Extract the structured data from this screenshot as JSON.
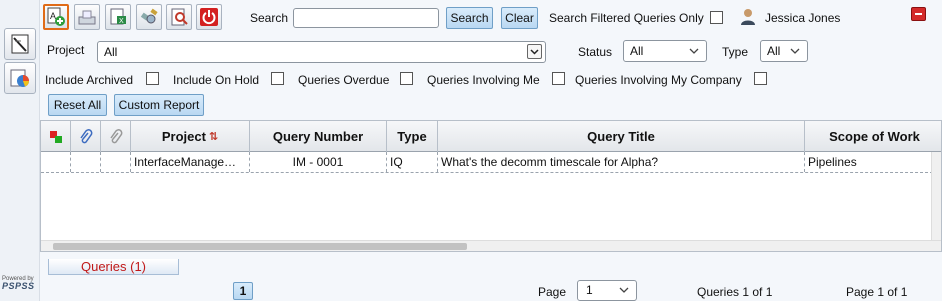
{
  "toolbar": {
    "icons": [
      "add-query-icon",
      "inbox-tray-icon",
      "export-excel-icon",
      "satellite-icon",
      "report-icon",
      "power-icon"
    ]
  },
  "search": {
    "label": "Search",
    "value": "",
    "search_button": "Search",
    "clear_button": "Clear",
    "filtered_only_label": "Search Filtered Queries Only"
  },
  "user": {
    "name": "Jessica Jones"
  },
  "filters": {
    "project_label": "Project",
    "project_value": "All",
    "status_label": "Status",
    "status_value": "All",
    "type_label": "Type",
    "type_value": "All",
    "include_archived": "Include Archived",
    "include_on_hold": "Include On Hold",
    "queries_overdue": "Queries Overdue",
    "involving_me": "Queries Involving Me",
    "involving_company": "Queries Involving My Company"
  },
  "actions": {
    "reset_all": "Reset All",
    "custom_report": "Custom Report"
  },
  "grid": {
    "columns": [
      "Project",
      "Query Number",
      "Type",
      "Query Title",
      "Scope of Work"
    ],
    "rows": [
      {
        "project": "InterfaceManage…",
        "query_number": "IM - 0001",
        "type": "IQ",
        "title": "What's the decomm timescale for Alpha?",
        "scope": "Pipelines"
      }
    ]
  },
  "footer": {
    "tab_label": "Queries (1)",
    "page_button": "1",
    "page_label": "Page",
    "page_value": "1",
    "queries_count": "Queries 1 of 1",
    "page_count": "Page 1 of 1"
  },
  "powered_by": {
    "label": "Powered by",
    "brand": "PSPSS"
  },
  "colors": {
    "accent": "#b9d8f2",
    "tab_text": "#c01818",
    "active_border": "#e06b17"
  }
}
